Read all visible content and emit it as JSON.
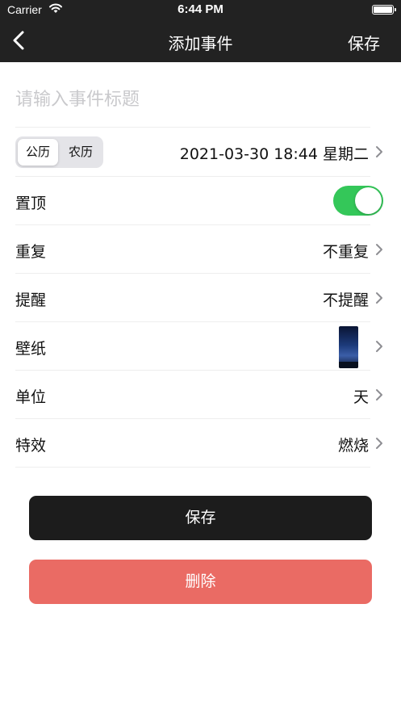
{
  "status_bar": {
    "carrier": "Carrier",
    "time": "6:44 PM"
  },
  "nav": {
    "title": "添加事件",
    "save_label": "保存"
  },
  "title_input": {
    "placeholder": "请输入事件标题",
    "value": ""
  },
  "calendar": {
    "options": [
      "公历",
      "农历"
    ],
    "selected": "公历",
    "datetime": "2021-03-30 18:44 星期二"
  },
  "rows": {
    "pin": {
      "label": "置顶",
      "on": true
    },
    "repeat": {
      "label": "重复",
      "value": "不重复"
    },
    "reminder": {
      "label": "提醒",
      "value": "不提醒"
    },
    "wallpaper": {
      "label": "壁纸"
    },
    "unit": {
      "label": "单位",
      "value": "天"
    },
    "effect": {
      "label": "特效",
      "value": "燃烧"
    }
  },
  "buttons": {
    "save": "保存",
    "delete": "删除"
  },
  "colors": {
    "nav_bg": "#222222",
    "toggle_on": "#34c759",
    "save_btn": "#1c1c1c",
    "delete_btn": "#ea6b64"
  },
  "icons": [
    "wifi-icon",
    "battery-icon",
    "back-chevron-icon",
    "chevron-right-icon"
  ]
}
